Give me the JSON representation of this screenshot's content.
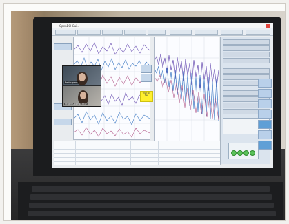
{
  "app": {
    "window_title": "OpenBCI Gui..."
  },
  "video_call": {
    "tile1_caption": "Participant",
    "tile2_caption": "Study Coordinator"
  },
  "markers": {
    "yellow_tag_text": "Wait 10 Sec"
  },
  "colors": {
    "screen_bg": "#e9ecef",
    "eeg_trace_a": "#6a4fb2",
    "eeg_trace_b": "#3a77c3",
    "eeg_trace_c": "#b35b8a",
    "status_green": "#5bc25b",
    "active_button_blue": "#5f9fd6",
    "highlight_yellow": "#ffef2e"
  }
}
